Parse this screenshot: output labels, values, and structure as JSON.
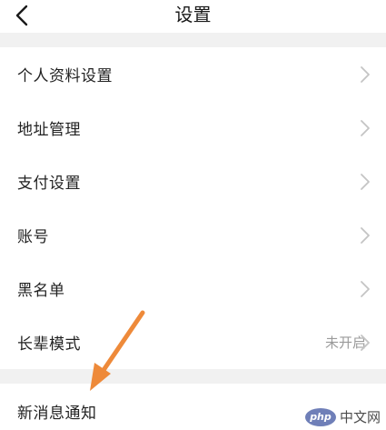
{
  "header": {
    "title": "设置",
    "back_icon": "chevron-left-icon"
  },
  "settings": {
    "items": [
      {
        "label": "个人资料设置",
        "icon": "chevron-right-icon"
      },
      {
        "label": "地址管理",
        "icon": "chevron-right-icon"
      },
      {
        "label": "支付设置",
        "icon": "chevron-right-icon"
      },
      {
        "label": "账号",
        "icon": "chevron-right-icon"
      },
      {
        "label": "黑名单",
        "icon": "chevron-right-icon"
      },
      {
        "label": "长辈模式",
        "status": "未开启",
        "icon": "chevron-right-icon"
      }
    ],
    "notification_item": {
      "label": "新消息通知"
    }
  },
  "annotation": {
    "arrow_color": "#ee8a3a"
  },
  "watermark": {
    "logo_text": "php",
    "site_text": "中文网"
  },
  "colors": {
    "section_gap": "#f1f1f1",
    "chevron": "#c4c4c4",
    "status_text": "#9a9a9a"
  }
}
